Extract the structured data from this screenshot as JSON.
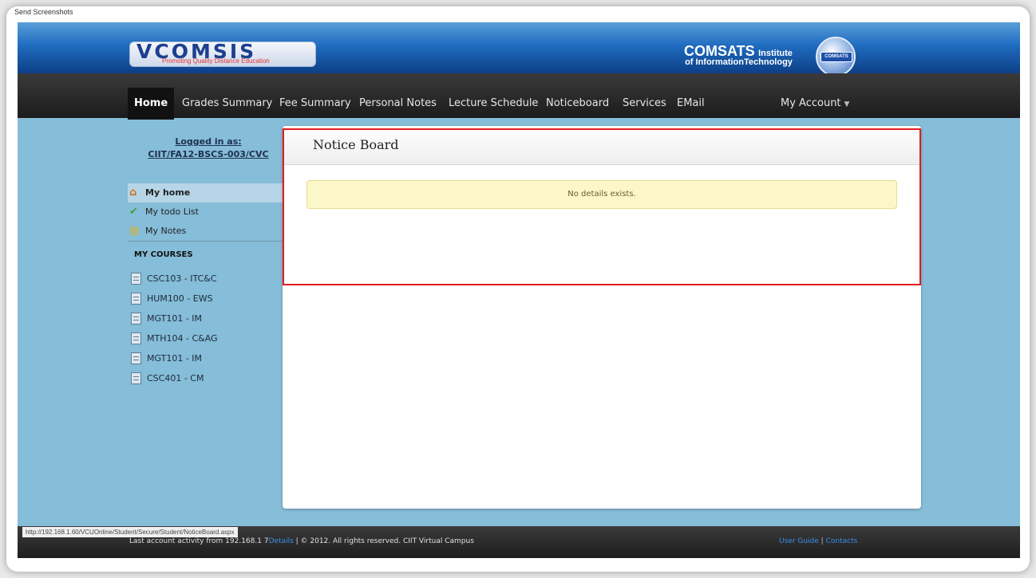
{
  "screenshot_tool_label": "Send Screenshots",
  "header": {
    "logo": "VCOMSIS",
    "logo_tagline": "Promoting Quality Distance Education",
    "institute_name": "COMSATS",
    "institute_suffix": "Institute",
    "institute_sub": "of InformationTechnology",
    "globe_label": "COMSATS"
  },
  "nav": {
    "items": [
      {
        "label": "Home"
      },
      {
        "label": "Grades Summary"
      },
      {
        "label": "Fee Summary"
      },
      {
        "label": "Personal Notes"
      },
      {
        "label": "Lecture Schedule"
      },
      {
        "label": "Noticeboard"
      },
      {
        "label": "Services"
      },
      {
        "label": "EMail"
      }
    ],
    "account": "My Account"
  },
  "sidebar": {
    "logged_in_label": "Logged in as:",
    "user_id": "CIIT/FA12-BSCS-003/CVC",
    "menu": [
      {
        "label": "My home",
        "icon": "home-icon"
      },
      {
        "label": "My todo List",
        "icon": "check-icon"
      },
      {
        "label": "My Notes",
        "icon": "note-icon"
      }
    ],
    "courses_heading": "MY COURSES",
    "courses": [
      {
        "label": "CSC103 - ITC&C"
      },
      {
        "label": "HUM100 - EWS"
      },
      {
        "label": "MGT101 - IM"
      },
      {
        "label": "MTH104 - C&AG"
      },
      {
        "label": "MGT101 - IM"
      },
      {
        "label": "CSC401 - CM"
      }
    ]
  },
  "main": {
    "title": "Notice Board",
    "message": "No details exists."
  },
  "footer": {
    "activity": "Last account activity from 192.168.1 7",
    "details_link": "Details",
    "copyright": " | © 2012. All rights reserved. CIIT Virtual Campus",
    "user_guide": "User Guide",
    "separator": " | ",
    "contacts": "Contacts"
  },
  "status_url": "http://192.168.1.60/VCUOnline/Student/Secure/Student/NoticeBoard.aspx",
  "colors": {
    "background": "#86bdd8",
    "highlight": "#e21b1b",
    "alert_bg": "#fcf7c8",
    "link": "#3a8ee8"
  }
}
